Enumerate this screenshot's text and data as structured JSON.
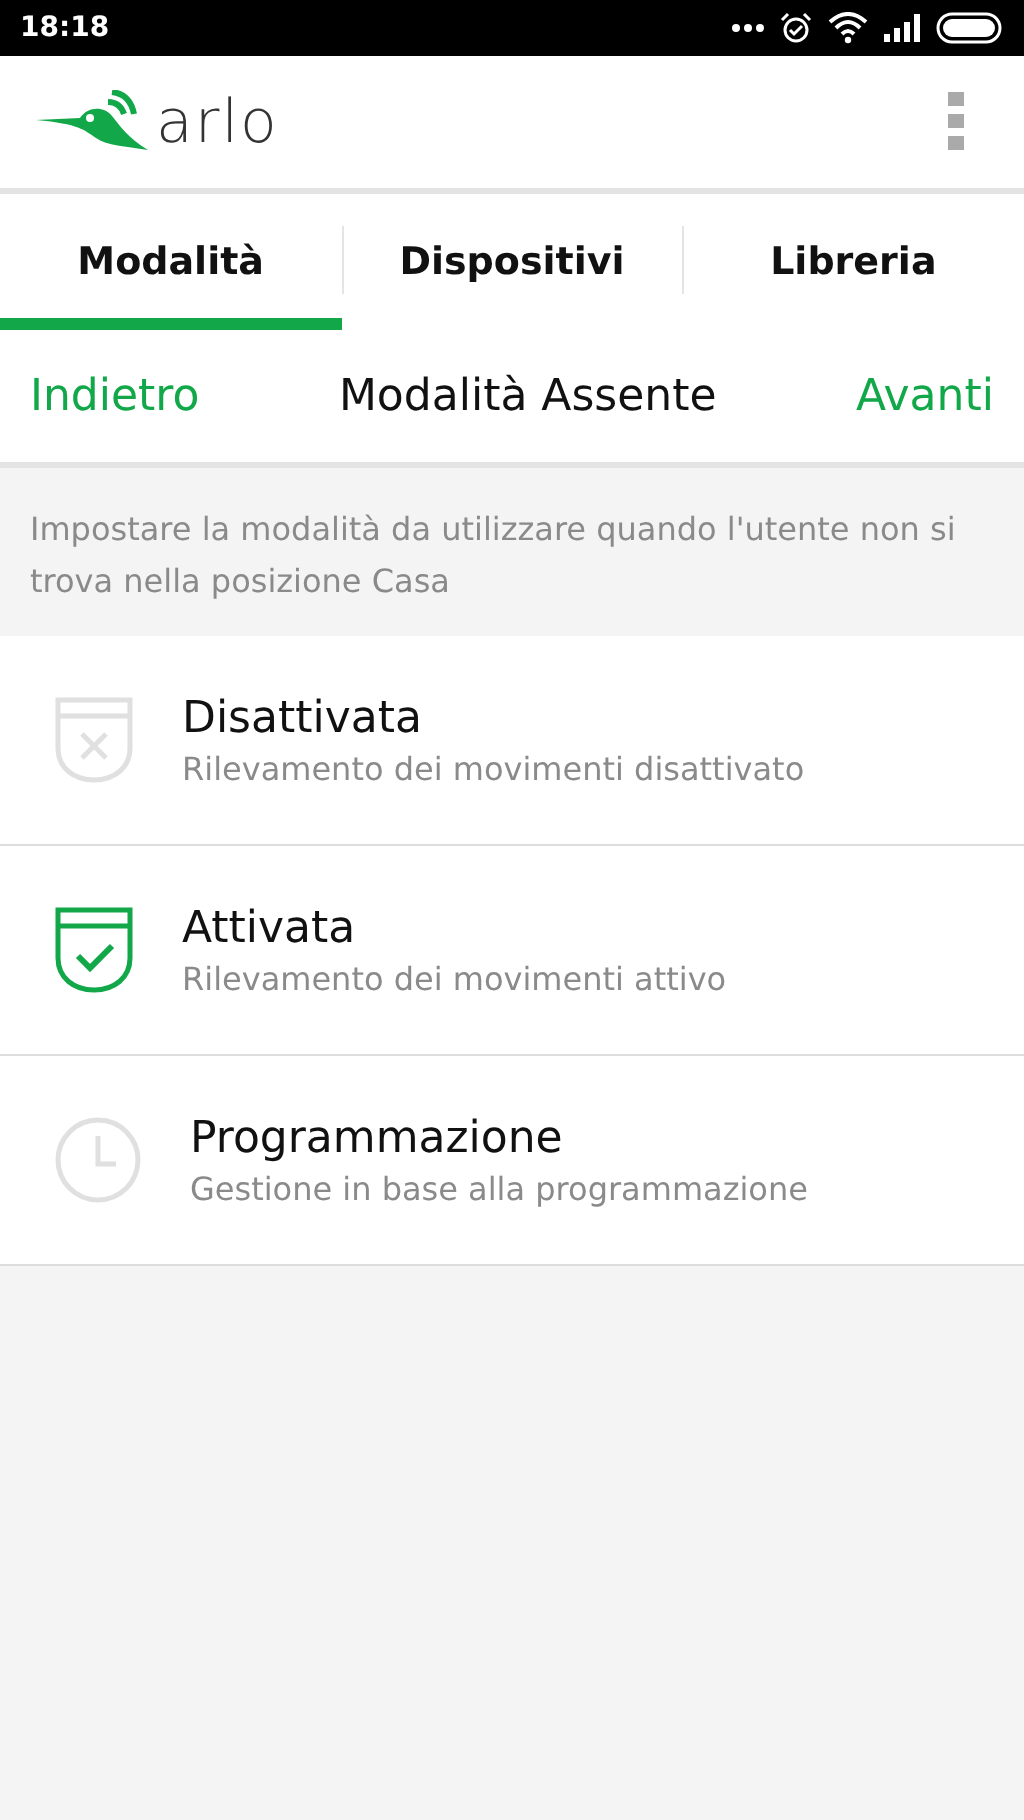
{
  "status_bar": {
    "time": "18:18"
  },
  "header": {
    "logo": "arlo"
  },
  "tabs": [
    {
      "label": "Modalità",
      "selected": true
    },
    {
      "label": "Dispositivi",
      "selected": false
    },
    {
      "label": "Libreria",
      "selected": false
    }
  ],
  "nav": {
    "back": "Indietro",
    "title": "Modalità Assente",
    "next": "Avanti"
  },
  "description": "Impostare la modalità da utilizzare quando l'utente non si trova nella posizione Casa",
  "modes": [
    {
      "kind": "shield-x",
      "title": "Disattivata",
      "subtitle": "Rilevamento dei movimenti disattivato",
      "selected": false
    },
    {
      "kind": "shield-check",
      "title": "Attivata",
      "subtitle": "Rilevamento dei movimenti attivo",
      "selected": true
    },
    {
      "kind": "clock",
      "title": "Programmazione",
      "subtitle": "Gestione in base alla programmazione",
      "selected": false
    }
  ]
}
